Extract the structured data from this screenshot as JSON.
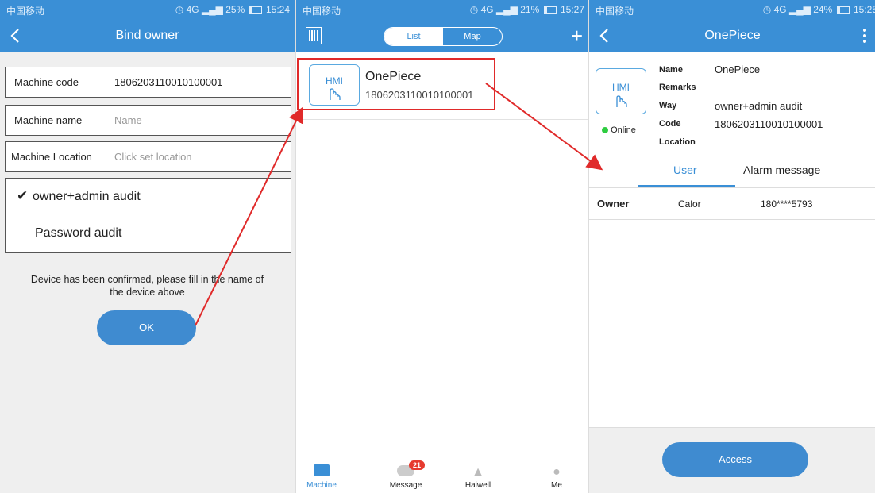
{
  "panel1": {
    "status": {
      "carrier": "中国移动",
      "signal": "4G",
      "battery": "25%",
      "time": "15:24"
    },
    "nav_title": "Bind owner",
    "machine_code": {
      "label": "Machine code",
      "value": "1806203110010100001"
    },
    "machine_name": {
      "label": "Machine name",
      "placeholder": "Name"
    },
    "machine_location": {
      "label": "Machine Location",
      "placeholder": "Click set location"
    },
    "audit_options": [
      "owner+admin audit",
      "Password audit"
    ],
    "note_line1": "Device has been confirmed, please fill in the name of",
    "note_line2": "the device above",
    "ok_label": "OK"
  },
  "panel2": {
    "status": {
      "carrier": "中国移动",
      "signal": "4G",
      "battery": "21%",
      "time": "15:27"
    },
    "tabs": {
      "list": "List",
      "map": "Map"
    },
    "plus": "+",
    "device": {
      "icon_text": "HMI",
      "name": "OnePiece",
      "code": "1806203110010100001"
    },
    "bottom_tabs": [
      "Machine",
      "Message",
      "Haiwell",
      "Me"
    ],
    "message_badge": "21",
    "accent": "#3a8fd6"
  },
  "panel3": {
    "status": {
      "carrier": "中国移动",
      "signal": "4G",
      "battery": "24%",
      "time": "15:25"
    },
    "nav_title": "OnePiece",
    "icon_text": "HMI",
    "online": "Online",
    "labels": {
      "name": "Name",
      "remarks": "Remarks",
      "way": "Way",
      "code": "Code",
      "location": "Location"
    },
    "values": {
      "name": "OnePiece",
      "way": "owner+admin audit",
      "code": "1806203110010100001"
    },
    "tabs": {
      "user": "User",
      "alarm": "Alarm message"
    },
    "row": {
      "role": "Owner",
      "name": "Calor",
      "phone": "180****5793"
    },
    "access_label": "Access"
  },
  "colors": {
    "primary": "#3a8fd6",
    "highlight": "#e02a2a",
    "online": "#2ecc40"
  }
}
